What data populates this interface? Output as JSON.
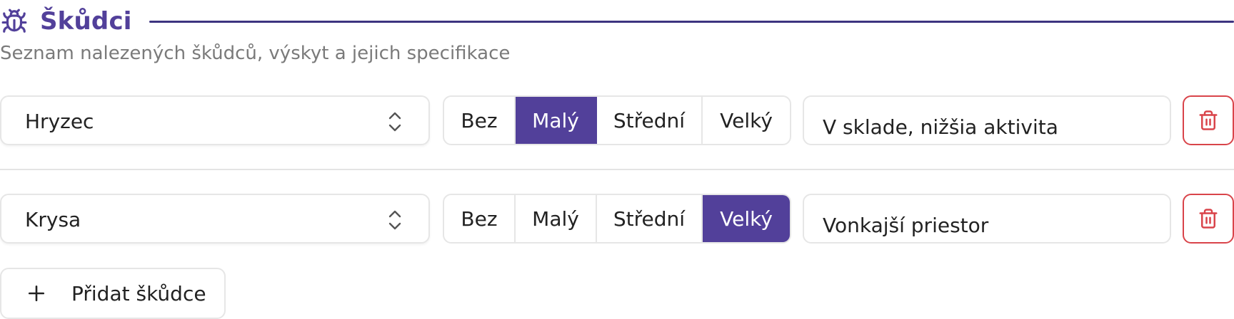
{
  "section": {
    "icon": "bug-icon",
    "title": "Škůdci",
    "subtitle": "Seznam nalezených škůdců, výskyt a jejich specifikace",
    "accent_color": "#52409a"
  },
  "severity_options": [
    "Bez",
    "Malý",
    "Střední",
    "Velký"
  ],
  "pests": [
    {
      "name": "Hryzec",
      "severity": "Malý",
      "note": "V sklade, nižšia aktivita"
    },
    {
      "name": "Krysa",
      "severity": "Velký",
      "note": "Vonkajší priestor"
    }
  ],
  "icons": {
    "select": "chevron-updown-icon",
    "delete": "trash-icon",
    "add": "plus-icon"
  },
  "colors": {
    "delete": "#d9444a",
    "active_segment": "#52409a"
  },
  "add_button": {
    "label": "Přidat škůdce"
  }
}
